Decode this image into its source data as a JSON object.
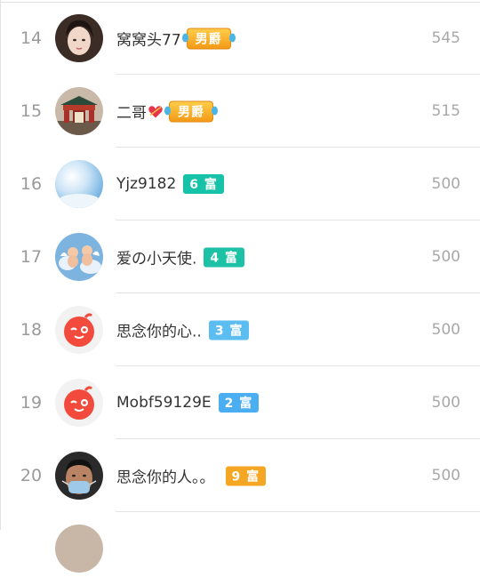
{
  "rows": [
    {
      "rank": "14",
      "name": "窝窝头77",
      "badge": "男爵",
      "score": "545",
      "avatar": "photo-woman"
    },
    {
      "rank": "15",
      "name": "二哥",
      "badge": "男爵",
      "score": "515",
      "avatar": "photo-gate"
    },
    {
      "rank": "16",
      "name": "Yjz9182",
      "badge": "6 富",
      "score": "500",
      "avatar": "photo-sky"
    },
    {
      "rank": "17",
      "name": "爱の小天使.",
      "badge": "4 富",
      "score": "500",
      "avatar": "photo-angels"
    },
    {
      "rank": "18",
      "name": "思念你的心..",
      "badge": "3 富",
      "score": "500",
      "avatar": "default-face"
    },
    {
      "rank": "19",
      "name": "Mobf59129E",
      "badge": "2 富",
      "score": "500",
      "avatar": "default-face"
    },
    {
      "rank": "20",
      "name": "思念你的人。。",
      "badge": "9 富",
      "score": "500",
      "avatar": "photo-man-mask"
    }
  ],
  "colors": {
    "rich_teal": "#16c2a8",
    "rich_blue": "#5bbdf0",
    "rich_gold": "#f5a623",
    "default_avatar": "#f24a3c"
  }
}
